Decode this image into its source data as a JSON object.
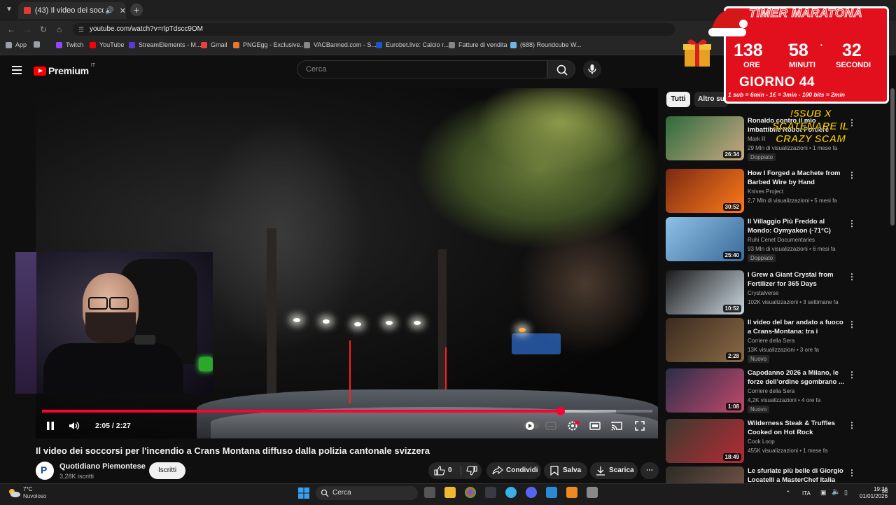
{
  "browser": {
    "tab_title": "(43) Il video dei soccorsi pe",
    "url": "youtube.com/watch?v=rlpTdscc9OM",
    "bookmarks": [
      {
        "label": "App",
        "color": "#9aa0a6"
      },
      {
        "label": "",
        "color": "#9aa0a6"
      },
      {
        "label": "Twitch",
        "color": "#9146ff"
      },
      {
        "label": "YouTube",
        "color": "#ff0000"
      },
      {
        "label": "StreamElements - M...",
        "color": "#5b3bd6"
      },
      {
        "label": "Gmail",
        "color": "#ea4335"
      },
      {
        "label": "PNGEgg - Exclusive...",
        "color": "#e8762d"
      },
      {
        "label": "VACBanned.com - S...",
        "color": "#888888"
      },
      {
        "label": "Eurobet.live: Calcio r...",
        "color": "#1a56c4"
      },
      {
        "label": "Fatture di vendita",
        "color": "#888888"
      },
      {
        "label": "(688) Roundcube W...",
        "color": "#6fb5e8"
      }
    ]
  },
  "youtube": {
    "region": "IT",
    "logo_word": "Premium",
    "search_placeholder": "Cerca"
  },
  "player": {
    "time": "2:05 / 2:27",
    "progress": 0.85,
    "buffered": 0.94
  },
  "video": {
    "title": "Il video dei soccorsi per l'incendio a Crans Montana diffuso dalla polizia cantonale svizzera",
    "channel": "Quotidiano Piemontese",
    "subscribers": "3,28K iscritti",
    "subscribe_label": "Iscritti",
    "likes": "0",
    "share_label": "Condividi",
    "save_label": "Salva",
    "download_label": "Scarica"
  },
  "chips": [
    {
      "label": "Tutti",
      "active": true
    },
    {
      "label": "Altro su",
      "active": false
    }
  ],
  "recommendations": [
    {
      "title": "Ronaldo contro il mio imbattibile Robot Portiere",
      "channel": "Mark R",
      "meta": "29 Mln di visualizzazioni • 1 mese fa",
      "badge": "Doppiato",
      "duration": "26:34",
      "thumb": [
        "#2d6b3c",
        "#c8a882"
      ]
    },
    {
      "title": "How I Forged a Machete from Barbed Wire by Hand",
      "channel": "Knives Project",
      "meta": "2,7 Mln di visualizzazioni • 5 mesi fa",
      "badge": "",
      "duration": "30:52",
      "thumb": [
        "#7a2a12",
        "#ff7a1a"
      ]
    },
    {
      "title": "Il Villaggio Più Freddo al Mondo: Oymyakon (-71°C)",
      "channel": "Ruhi Cenet Documentaries",
      "meta": "93 Mln di visualizzazioni • 6 mesi fa",
      "badge": "Doppiato",
      "duration": "25:40",
      "thumb": [
        "#8ec1e6",
        "#3a6a9a"
      ]
    },
    {
      "title": "I Grew a Giant Crystal from Fertilizer for 365 Days",
      "channel": "Crystalverse",
      "meta": "102K visualizzazioni • 3 settimane fa",
      "badge": "",
      "duration": "10:52",
      "thumb": [
        "#1a1a1a",
        "#c9d6de"
      ]
    },
    {
      "title": "Il video del bar andato a fuoco a Crans-Montana: tra i divanetti ...",
      "channel": "Corriere della Sera",
      "meta": "13K visualizzazioni • 3 ore fa",
      "badge": "Nuovo",
      "duration": "2:28",
      "thumb": [
        "#3a2a1e",
        "#8a6a46"
      ]
    },
    {
      "title": "Capodanno 2026 a Milano, le forze dell'ordine sgombrano ...",
      "channel": "Corriere della Sera",
      "meta": "4,2K visualizzazioni • 4 ore fa",
      "badge": "Nuovo",
      "duration": "1:08",
      "thumb": [
        "#2a2e4a",
        "#c2486a"
      ]
    },
    {
      "title": "Wilderness Steak & Truffles Cooked on Hot Rock",
      "channel": "Cook Loop",
      "meta": "455K visualizzazioni • 1 mese fa",
      "badge": "",
      "duration": "18:49",
      "thumb": [
        "#3a3a2e",
        "#b82a36"
      ]
    },
    {
      "title": "Le sfuriate più belle di Giorgio Locatelli a MasterChef Italia",
      "channel": "",
      "meta": "",
      "badge": "",
      "duration": "",
      "thumb": [
        "#2e2a26",
        "#7a5a4a"
      ]
    }
  ],
  "timer": {
    "title": "TIMER MARATONA",
    "hours": "138",
    "minutes": "58",
    "seconds": "32",
    "hours_label": "ORE",
    "minutes_label": "MINUTI",
    "seconds_label": "SECONDI",
    "day": "GIORNO 44",
    "rules": "1 sub = 6min - 1€ = 3min - 100 bits = 2min"
  },
  "promo": {
    "line1": "!5SUB X",
    "line2": "SCATENARE IL",
    "line3": "CRAZY SCAM"
  },
  "taskbar": {
    "temp": "7°C",
    "weather": "Nuvoloso",
    "search": "Cerca",
    "lang": "ITA",
    "time": "19:36",
    "date": "01/01/2026"
  }
}
